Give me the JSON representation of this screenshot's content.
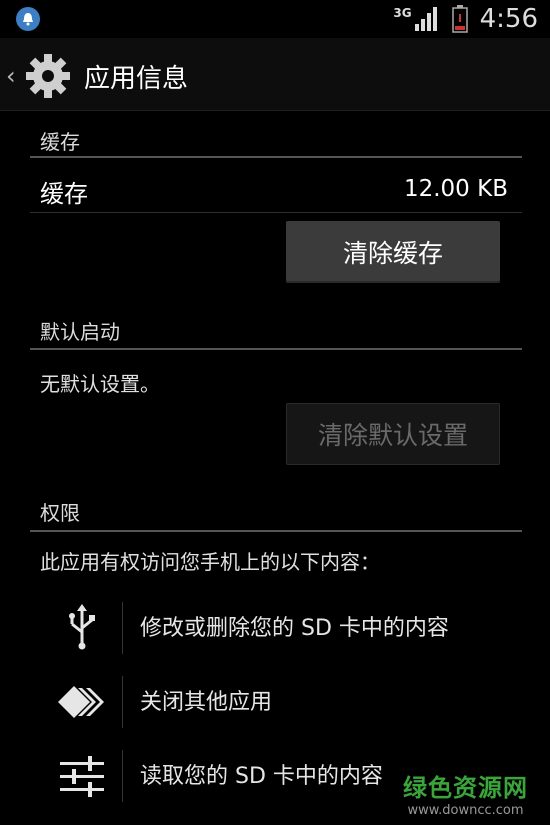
{
  "status_bar": {
    "network": "3G",
    "time": "4:56",
    "icons": [
      "bell-notification-icon",
      "signal-icon",
      "battery-icon"
    ]
  },
  "action_bar": {
    "back_glyph": "‹",
    "title": "应用信息",
    "icon": "gear-icon"
  },
  "cache": {
    "header": "缓存",
    "row_label": "缓存",
    "row_value": "12.00 KB",
    "clear_button": "清除缓存"
  },
  "defaults": {
    "header": "默认启动",
    "description": "无默认设置。",
    "clear_button": "清除默认设置"
  },
  "permissions": {
    "header": "权限",
    "intro": "此应用有权访问您手机上的以下内容：",
    "items": [
      {
        "icon": "usb-icon",
        "label": "修改或删除您的 SD 卡中的内容"
      },
      {
        "icon": "close-apps-icon",
        "label": "关闭其他应用"
      },
      {
        "icon": "sliders-icon",
        "label": "读取您的 SD 卡中的内容"
      }
    ]
  },
  "watermark": {
    "title": "绿色资源网",
    "url": "www.downcc.com"
  },
  "colors": {
    "background": "#000000",
    "notification_badge": "#3d7fc4",
    "watermark_green": "#3aa53a"
  }
}
